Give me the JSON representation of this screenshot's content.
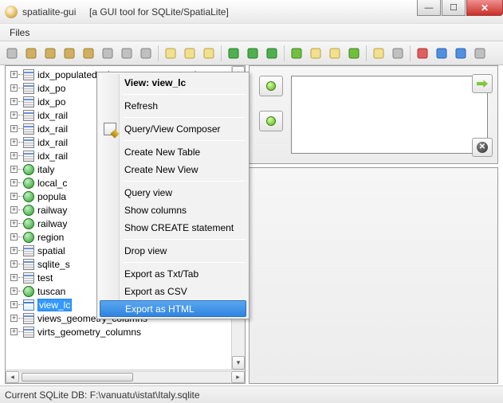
{
  "window": {
    "app_name": "spatialite-gui",
    "subtitle": "[a GUI tool for SQLite/SpatiaLite]"
  },
  "menubar": {
    "files": "Files"
  },
  "toolbar_icons": [
    "wand-icon",
    "db-new-icon",
    "db-open-icon",
    "memory-db-icon",
    "network-db-icon",
    "attach-icon",
    "link-icon",
    "disconnect-icon",
    "import-table-icon",
    "export-table-icon",
    "edit-doc-icon",
    "globe-icon",
    "globe-export-icon",
    "globe-minus-icon",
    "run-icon",
    "pic-icon",
    "add-pic-icon",
    "doc-arrow-icon",
    "export-xml-icon",
    "wrench-icon",
    "text-a-icon",
    "help-icon",
    "info-icon",
    "geom-icon"
  ],
  "tree": [
    {
      "icon": "tbl",
      "label": "idx_populated_places_geometry_node"
    },
    {
      "icon": "tbl",
      "label": "idx_po"
    },
    {
      "icon": "tbl",
      "label": "idx_po"
    },
    {
      "icon": "tbl",
      "label": "idx_rail"
    },
    {
      "icon": "tbl",
      "label": "idx_rail"
    },
    {
      "icon": "tbl",
      "label": "idx_rail"
    },
    {
      "icon": "tbl",
      "label": "idx_rail"
    },
    {
      "icon": "globe",
      "label": "italy"
    },
    {
      "icon": "globe",
      "label": "local_c"
    },
    {
      "icon": "globe",
      "label": "popula"
    },
    {
      "icon": "globe",
      "label": "railway"
    },
    {
      "icon": "globe",
      "label": "railway"
    },
    {
      "icon": "globe",
      "label": "region"
    },
    {
      "icon": "tbl",
      "label": "spatial"
    },
    {
      "icon": "tbl",
      "label": "sqlite_s"
    },
    {
      "icon": "tbl",
      "label": "test"
    },
    {
      "icon": "globe",
      "label": "tuscan"
    },
    {
      "icon": "view",
      "label": "view_lc",
      "selected": true
    },
    {
      "icon": "tbl",
      "label": "views_geometry_columns"
    },
    {
      "icon": "tbl",
      "label": "virts_geometry_columns"
    }
  ],
  "context_menu": {
    "title": "View:  view_lc",
    "items": [
      {
        "type": "item",
        "label": "Refresh"
      },
      {
        "type": "sep"
      },
      {
        "type": "item",
        "label": "Query/View Composer",
        "icon": "compose"
      },
      {
        "type": "sep"
      },
      {
        "type": "item",
        "label": "Create New Table"
      },
      {
        "type": "item",
        "label": "Create New View"
      },
      {
        "type": "sep"
      },
      {
        "type": "item",
        "label": "Query view"
      },
      {
        "type": "item",
        "label": "Show columns"
      },
      {
        "type": "item",
        "label": "Show CREATE statement"
      },
      {
        "type": "sep"
      },
      {
        "type": "item",
        "label": "Drop view"
      },
      {
        "type": "sep"
      },
      {
        "type": "item",
        "label": "Export as Txt/Tab"
      },
      {
        "type": "item",
        "label": "Export as CSV"
      },
      {
        "type": "item",
        "label": "Export as HTML",
        "hover": true
      }
    ]
  },
  "statusbar": {
    "text": "Current SQLite DB: F:\\vanuatu\\istat\\Italy.sqlite"
  }
}
